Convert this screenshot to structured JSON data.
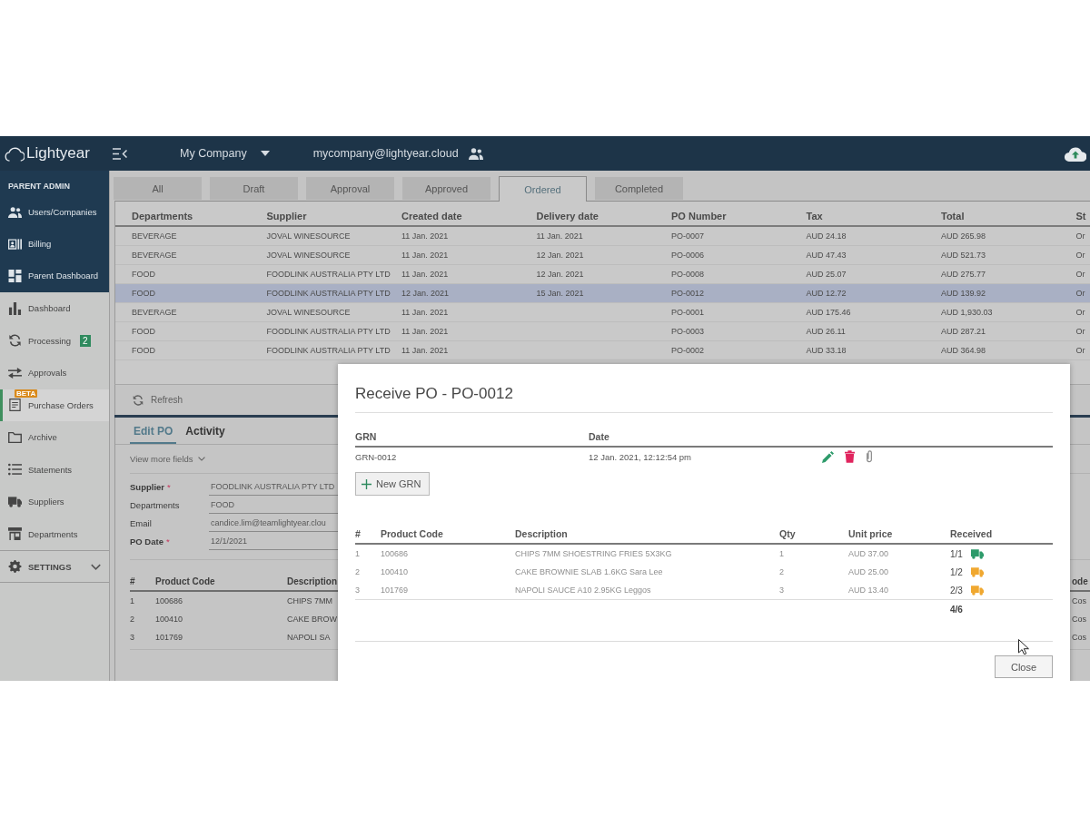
{
  "header": {
    "brand": "Lightyear",
    "company": "My Company",
    "account": "mycompany@lightyear.cloud"
  },
  "sidebar": {
    "admin_title": "PARENT ADMIN",
    "admin_items": [
      {
        "label": "Users/Companies",
        "selected": false
      },
      {
        "label": "Billing",
        "selected": false
      },
      {
        "label": "Parent Dashboard",
        "selected": false
      }
    ],
    "items": [
      {
        "label": "Dashboard",
        "selected": false
      },
      {
        "label": "Processing",
        "selected": false,
        "badge": "2"
      },
      {
        "label": "Approvals",
        "selected": false
      },
      {
        "label": "Purchase Orders",
        "selected": true,
        "tag": "BETA"
      },
      {
        "label": "Archive",
        "selected": false
      },
      {
        "label": "Statements",
        "selected": false
      },
      {
        "label": "Suppliers",
        "selected": false
      },
      {
        "label": "Departments",
        "selected": false
      }
    ],
    "settings": {
      "label": "SETTINGS",
      "expanded": false
    }
  },
  "status_tabs": [
    {
      "label": "All",
      "selected": false
    },
    {
      "label": "Draft",
      "selected": false
    },
    {
      "label": "Approval",
      "selected": false
    },
    {
      "label": "Approved",
      "selected": false
    },
    {
      "label": "Ordered",
      "selected": true
    },
    {
      "label": "Completed",
      "selected": false
    }
  ],
  "orders_table": {
    "columns": [
      "Departments",
      "Supplier",
      "Created date",
      "Delivery date",
      "PO Number",
      "Tax",
      "Total",
      "St"
    ],
    "rows": [
      {
        "departments": "BEVERAGE",
        "supplier": "JOVAL WINESOURCE",
        "created_date": "11 Jan. 2021",
        "delivery_date": "11 Jan. 2021",
        "po_number": "PO-0007",
        "tax": "AUD 24.18",
        "total": "AUD 265.98",
        "column_8": "Or",
        "selected": false
      },
      {
        "departments": "BEVERAGE",
        "supplier": "JOVAL WINESOURCE",
        "created_date": "11 Jan. 2021",
        "delivery_date": "12 Jan. 2021",
        "po_number": "PO-0006",
        "tax": "AUD 47.43",
        "total": "AUD 521.73",
        "column_8": "Or",
        "selected": false
      },
      {
        "departments": "FOOD",
        "supplier": "FOODLINK AUSTRALIA PTY LTD",
        "created_date": "11 Jan. 2021",
        "delivery_date": "12 Jan. 2021",
        "po_number": "PO-0008",
        "tax": "AUD 25.07",
        "total": "AUD 275.77",
        "column_8": "Or",
        "selected": false
      },
      {
        "departments": "FOOD",
        "supplier": "FOODLINK AUSTRALIA PTY LTD",
        "created_date": "12 Jan. 2021",
        "delivery_date": "15 Jan. 2021",
        "po_number": "PO-0012",
        "tax": "AUD 12.72",
        "total": "AUD 139.92",
        "column_8": "Or",
        "selected": true
      },
      {
        "departments": "BEVERAGE",
        "supplier": "JOVAL WINESOURCE",
        "created_date": "11 Jan. 2021",
        "po_number": "PO-0001",
        "tax": "AUD 175.46",
        "total": "AUD 1,930.03",
        "column_8": "Or",
        "selected": false
      },
      {
        "departments": "FOOD",
        "supplier": "FOODLINK AUSTRALIA PTY LTD",
        "created_date": "11 Jan. 2021",
        "po_number": "PO-0003",
        "tax": "AUD 26.11",
        "total": "AUD 287.21",
        "column_8": "Or",
        "selected": false
      },
      {
        "departments": "FOOD",
        "supplier": "FOODLINK AUSTRALIA PTY LTD",
        "created_date": "11 Jan. 2021",
        "po_number": "PO-0002",
        "tax": "AUD 33.18",
        "total": "AUD 364.98",
        "column_8": "Or",
        "selected": false
      }
    ]
  },
  "refresh": {
    "label": "Refresh",
    "disabled": true
  },
  "edit_panel": {
    "tabs": [
      {
        "label": "Edit PO",
        "selected": true
      },
      {
        "label": "Activity",
        "selected": false
      }
    ],
    "more_fields": "View more fields",
    "fields": [
      {
        "label": "Supplier",
        "required_mark": "*",
        "value": "FOODLINK AUSTRALIA PTY LTD"
      },
      {
        "label": "Departments",
        "value": "FOOD"
      },
      {
        "label": "Email",
        "value": "candice.lim@teamlightyear.clou"
      },
      {
        "label": "PO Date",
        "required_mark": "*",
        "value": "12/1/2021"
      }
    ],
    "lines": {
      "columns": [
        "#",
        "Product Code",
        "Description",
        "ode"
      ],
      "rows": [
        {
          "number": "1",
          "product_code": "100686",
          "description": "CHIPS 7MM",
          "column_4": "Cos"
        },
        {
          "number": "2",
          "product_code": "100410",
          "description": "CAKE BROW",
          "column_4": "Cos"
        },
        {
          "number": "3",
          "product_code": "101769",
          "description": "NAPOLI SA",
          "column_4": "Cos"
        }
      ]
    }
  },
  "receive_dialog": {
    "title": "Receive PO - PO-0012",
    "grn_table": {
      "columns": [
        "GRN",
        "Date"
      ],
      "rows": [
        {
          "grn": "GRN-0012",
          "date": "12 Jan. 2021, 12:12:54 pm"
        }
      ]
    },
    "new_button": "New GRN",
    "products": {
      "columns": [
        "#",
        "Product Code",
        "Description",
        "Qty",
        "Unit price",
        "Received"
      ],
      "rows": [
        {
          "number": "1",
          "product_code": "100686",
          "description": "CHIPS 7MM SHOESTRING FRIES 5X3KG",
          "qty": "1",
          "unit_price": "AUD 37.00",
          "received": "1/1",
          "color": "#2e9b6b"
        },
        {
          "number": "2",
          "product_code": "100410",
          "description": "CAKE BROWNIE SLAB 1.6KG Sara Lee",
          "qty": "2",
          "unit_price": "AUD 25.00",
          "received": "1/2",
          "color": "#f0a830"
        },
        {
          "number": "3",
          "product_code": "101769",
          "description": "NAPOLI SAUCE A10 2.95KG Leggos",
          "qty": "3",
          "unit_price": "AUD 13.40",
          "received": "2/3",
          "color": "#f0a830"
        }
      ],
      "total_received": "4/6"
    },
    "close_button": "Close"
  }
}
